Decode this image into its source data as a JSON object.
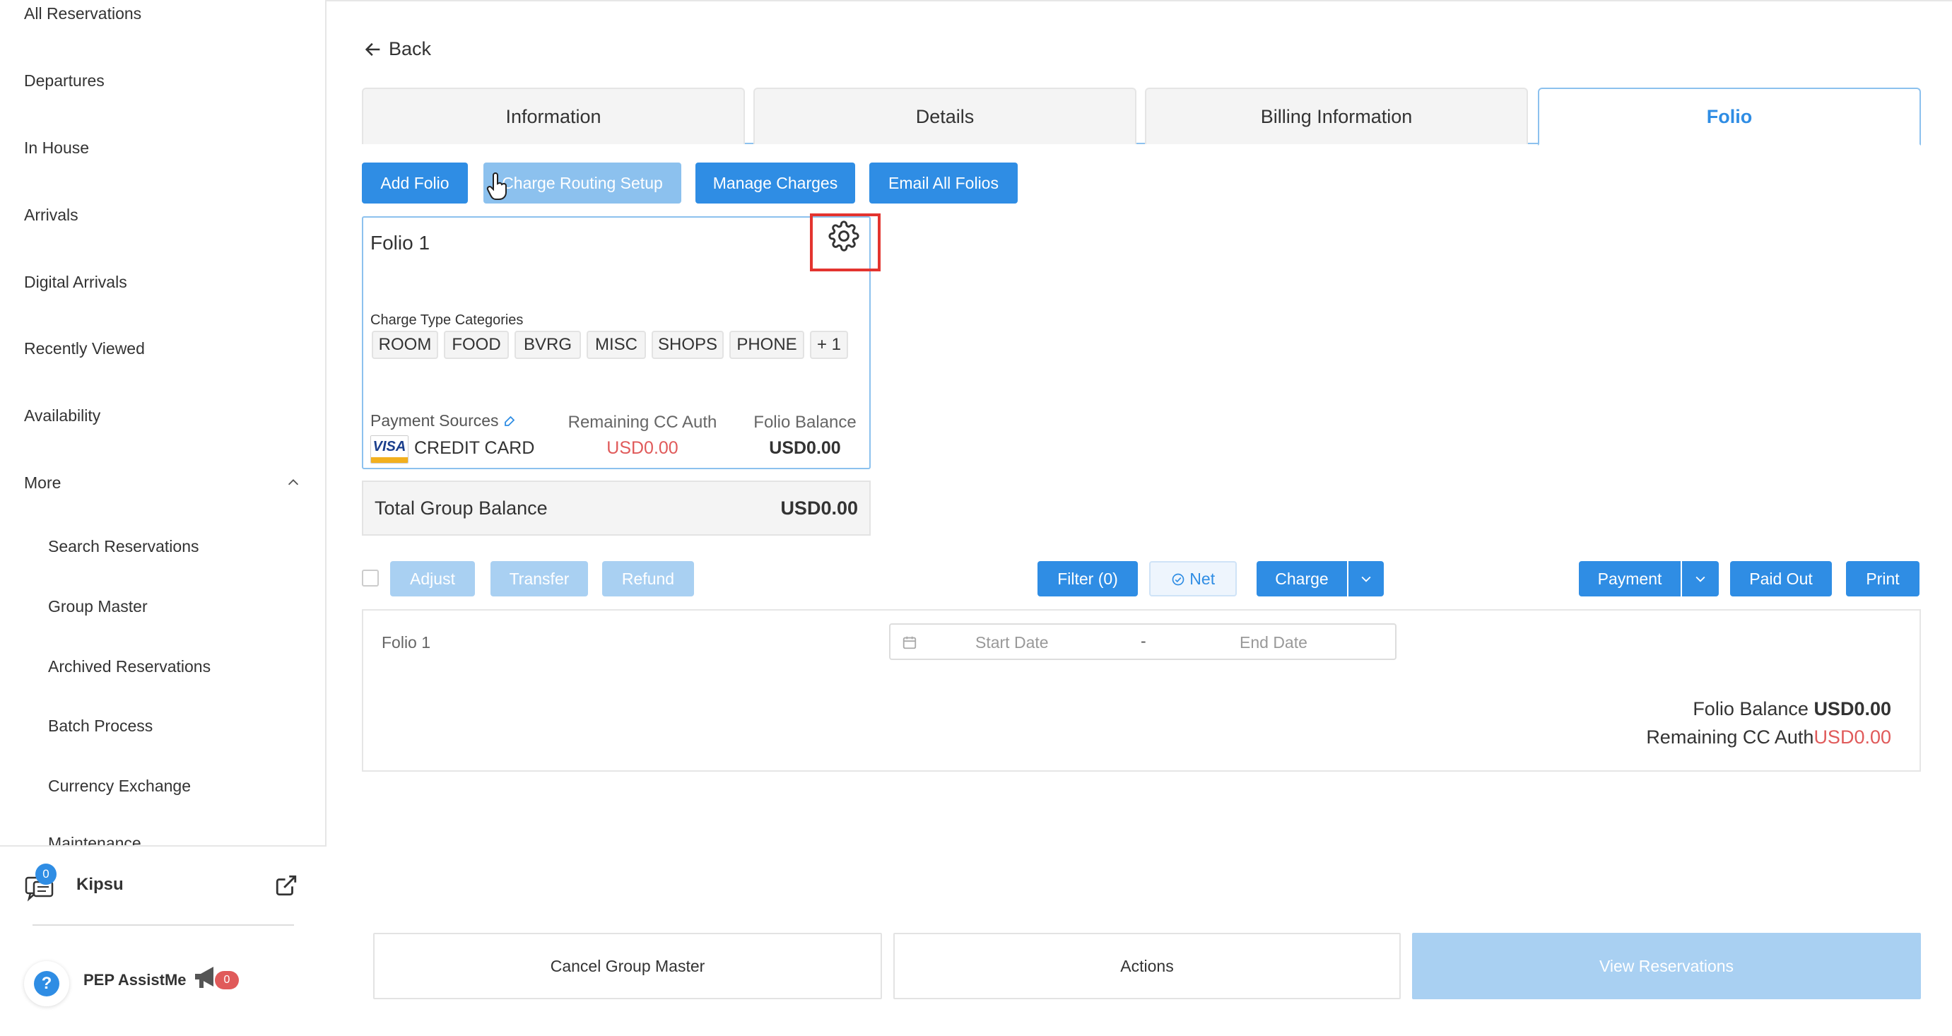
{
  "sidebar": {
    "items": [
      {
        "label": "All Reservations"
      },
      {
        "label": "Departures"
      },
      {
        "label": "In House"
      },
      {
        "label": "Arrivals"
      },
      {
        "label": "Digital Arrivals"
      },
      {
        "label": "Recently Viewed"
      },
      {
        "label": "Availability"
      },
      {
        "label": "More"
      }
    ],
    "subitems": [
      {
        "label": "Search Reservations"
      },
      {
        "label": "Group Master"
      },
      {
        "label": "Archived Reservations"
      },
      {
        "label": "Batch Process"
      },
      {
        "label": "Currency Exchange"
      },
      {
        "label": "Maintenance"
      }
    ],
    "kipsu": {
      "label": "Kipsu",
      "badge": "0"
    },
    "pep": {
      "label": "PEP AssistMe",
      "badge": "0"
    }
  },
  "back_label": "Back",
  "tabs": [
    {
      "label": "Information"
    },
    {
      "label": "Details"
    },
    {
      "label": "Billing Information"
    },
    {
      "label": "Folio"
    }
  ],
  "actions": {
    "add_folio": "Add Folio",
    "charge_routing": "Charge Routing Setup",
    "manage_charges": "Manage Charges",
    "email_all": "Email All Folios"
  },
  "folio_card": {
    "title": "Folio 1",
    "ctc_label": "Charge Type Categories",
    "chips": [
      "ROOM",
      "FOOD",
      "BVRG",
      "MISC",
      "SHOPS",
      "PHONE",
      "+ 1"
    ],
    "payment_sources_label": "Payment Sources",
    "card_brand": "VISA",
    "card_label": "CREDIT CARD",
    "remaining_cc_auth_label": "Remaining CC Auth",
    "remaining_cc_auth_value": "USD0.00",
    "folio_balance_label": "Folio Balance",
    "folio_balance_value": "USD0.00"
  },
  "total_group": {
    "label": "Total Group Balance",
    "value": "USD0.00"
  },
  "toolbar": {
    "adjust": "Adjust",
    "transfer": "Transfer",
    "refund": "Refund",
    "filter": "Filter (0)",
    "net": "Net",
    "charge": "Charge",
    "payment": "Payment",
    "paid_out": "Paid Out",
    "print": "Print"
  },
  "panel": {
    "folio_label": "Folio 1",
    "start_placeholder": "Start Date",
    "separator": "-",
    "end_placeholder": "End Date",
    "folio_balance_label": "Folio Balance",
    "folio_balance_value": "USD0.00",
    "remaining_label": "Remaining CC Auth",
    "remaining_value": "USD0.00"
  },
  "bottom": {
    "cancel": "Cancel Group Master",
    "actions": "Actions",
    "view": "View Reservations"
  },
  "colors": {
    "primary": "#2f8de4",
    "primary_light": "#8cc1ee",
    "danger": "#e05a5a",
    "highlight": "#e3342f"
  }
}
